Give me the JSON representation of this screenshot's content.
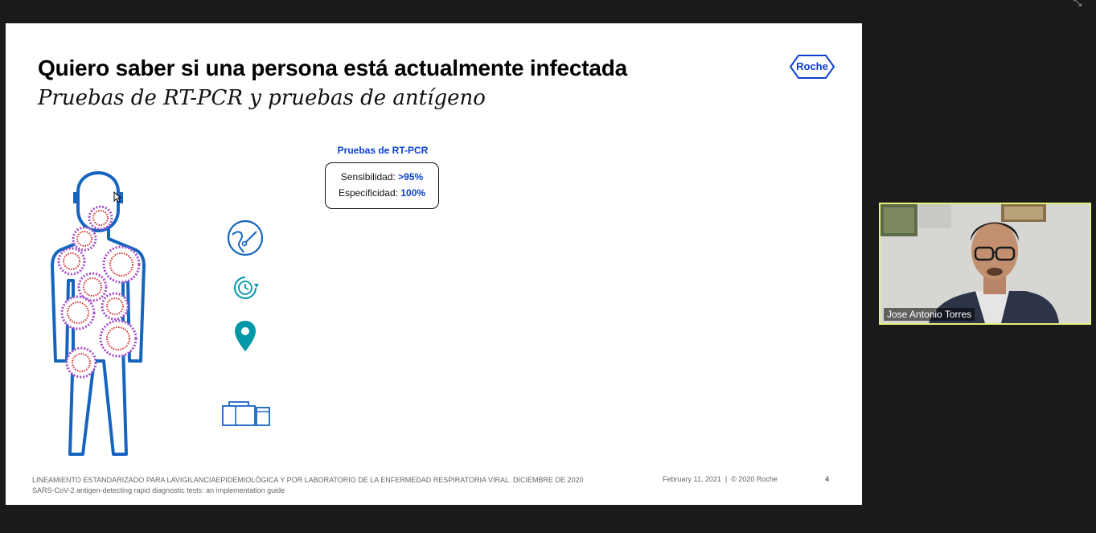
{
  "window": {
    "exit_fullscreen_icon": "shrink-arrows-icon"
  },
  "slide": {
    "title": "Quiero saber si una persona está actualmente infectada",
    "subtitle": "Pruebas de RT-PCR y pruebas de antígeno",
    "logo": "Roche",
    "test_heading": "Pruebas de RT-PCR",
    "stats": [
      {
        "label": "Sensibilidad:",
        "value": ">95%"
      },
      {
        "label": "Especificidad:",
        "value": "100%"
      }
    ],
    "icons": [
      "swab-test-icon",
      "clock-refresh-icon",
      "location-pin-icon",
      "laboratory-equipment-icon"
    ],
    "footer": {
      "reference_1": "LINEAMIENTO ESTANDARIZADO PARA LAVIGILANCIAEPIDEMIOLÓGICA Y POR LABORATORIO DE LA ENFERMEDAD RESPIRATORIA VIRAL. DICIEMBRE DE 2020",
      "reference_2": "SARS-CoV-2 antigen-detecting rapid diagnostic tests: an implementation guide",
      "date_copyright": "February 11, 2021  |  © 2020 Roche",
      "page_number": "4"
    }
  },
  "video": {
    "participant_name": "Jose Antonio Torres"
  },
  "colors": {
    "roche_blue": "#0b41cd",
    "figure_blue": "#1565c0",
    "teal": "#0097a7",
    "virus_purple": "#a64ac9",
    "virus_red": "#d32f2f",
    "video_border": "#e7f07a"
  }
}
